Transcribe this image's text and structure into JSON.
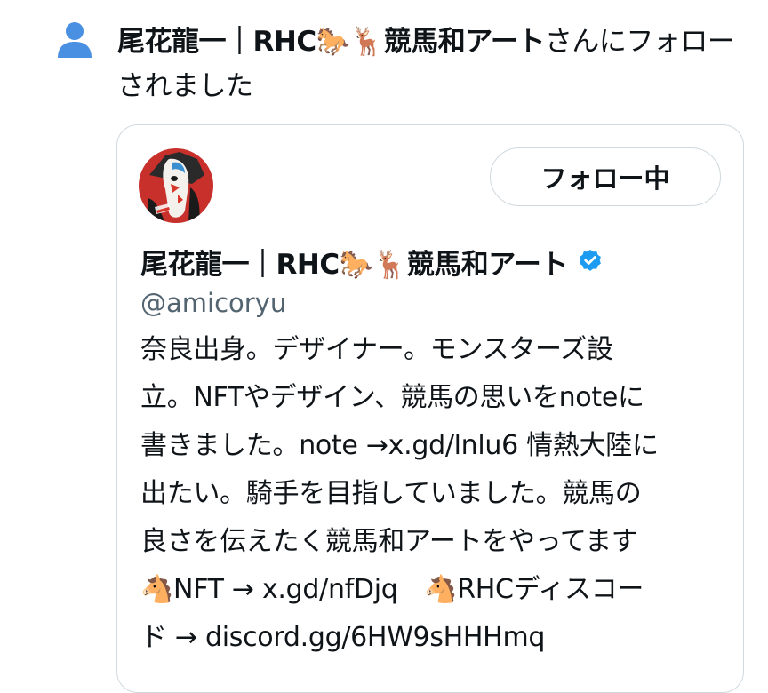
{
  "notification": {
    "icon": "person-icon",
    "user_name": "尾花龍一｜RHC🐎🦌競馬和アート",
    "action_text": "さんにフォローされました"
  },
  "card": {
    "avatar": "horse-avatar",
    "follow_button_label": "フォロー中",
    "display_name": "尾花龍一｜RHC🐎🦌競馬和アート",
    "verified_icon": "verified-badge-icon",
    "handle": "@amicoryu",
    "bio": "奈良出身。デザイナー。モンスターズ設\n立。NFTやデザイン、競馬の思いをnoteに\n書きました。note →x.gd/lnlu6 情熱大陸に\n出たい。騎手を目指していました。競馬の\n良さを伝えたく競馬和アートをやってます\n🐴NFT → x.gd/nfDjq　🐴RHCディスコー\nド → discord.gg/6HW9sHHHmq"
  },
  "colors": {
    "text": "#0f1419",
    "secondary_text": "#536471",
    "border": "#cfd9de",
    "person_icon": "#4a90e2",
    "verified": "#1d9bf0",
    "avatar_bg": "#c8302c"
  }
}
